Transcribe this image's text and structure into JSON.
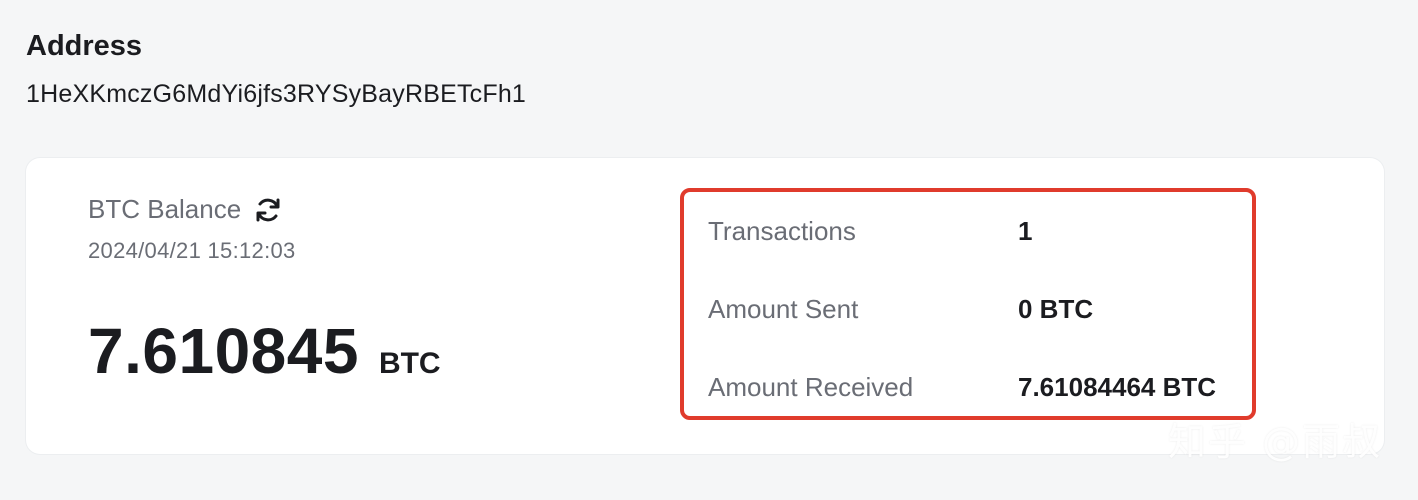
{
  "address": {
    "title": "Address",
    "value": "1HeXKmczG6MdYi6jfs3RYSyBayRBETcFh1"
  },
  "balance": {
    "label": "BTC Balance",
    "refresh_icon": "refresh-icon",
    "timestamp": "2024/04/21 15:12:03",
    "amount": "7.610845",
    "unit": "BTC"
  },
  "stats": [
    {
      "label": "Transactions",
      "value": "1"
    },
    {
      "label": "Amount Sent",
      "value": "0 BTC"
    },
    {
      "label": "Amount Received",
      "value": "7.61084464 BTC"
    }
  ],
  "watermark": "知乎 @雨叔",
  "colors": {
    "highlight_border": "#e03b2c",
    "card_bg": "#ffffff",
    "page_bg": "#f5f6f7",
    "muted_text": "#6a6d75",
    "primary_text": "#1b1c20"
  }
}
